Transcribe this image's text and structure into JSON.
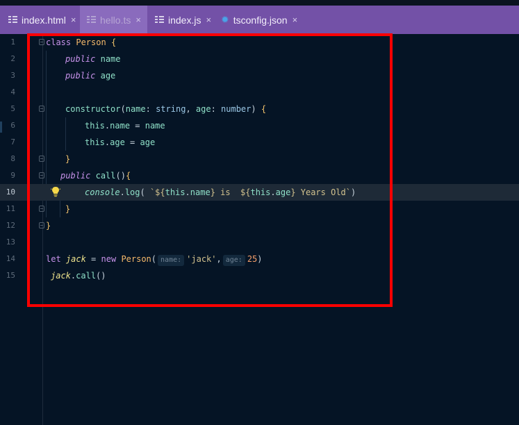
{
  "tabs": [
    {
      "label": "index.html",
      "close": "×",
      "icon": "file-lines-icon"
    },
    {
      "label": "hello.ts",
      "close": "×",
      "icon": "file-lines-icon",
      "active": true
    },
    {
      "label": "index.js",
      "close": "×",
      "icon": "file-lines-icon"
    },
    {
      "label": "tsconfig.json",
      "close": "×",
      "icon": "gear-icon"
    }
  ],
  "line_numbers": [
    "1",
    "2",
    "3",
    "4",
    "5",
    "6",
    "7",
    "8",
    "9",
    "10",
    "11",
    "12",
    "13",
    "14",
    "15"
  ],
  "current_line": "10",
  "code": {
    "l1": {
      "kw": "class",
      "cls": "Person",
      "brace": "{"
    },
    "l2": {
      "kw": "public",
      "name": "name"
    },
    "l3": {
      "kw": "public",
      "name": "age"
    },
    "l5": {
      "fn": "constructor",
      "open": "(",
      "p1": "name",
      "c1": ": ",
      "t1": "string",
      "comma": ", ",
      "p2": "age",
      "c2": ": ",
      "t2": "number",
      "close": ")",
      "brace": "{"
    },
    "l6": {
      "this": "this",
      "dot": ".",
      "prop": "name",
      "eq": " = ",
      "val": "name"
    },
    "l7": {
      "this": "this",
      "dot": ".",
      "prop": "age",
      "eq": " = ",
      "val": "age"
    },
    "l8": {
      "brace": "}"
    },
    "l9": {
      "kw": "public",
      "fn": "call",
      "paren": "()",
      "brace": "{"
    },
    "l10": {
      "obj": "console",
      "dot": ".",
      "fn": "log",
      "open": "(",
      "tpl_start": " `${",
      "this1": "this",
      "dot1": ".",
      "p1": "name",
      "mid": "} is  ${",
      "this2": "this",
      "dot2": ".",
      "p2": "age",
      "end": "} Years Old`",
      "close": ")"
    },
    "l11": {
      "brace": "}"
    },
    "l12": {
      "brace": "}"
    },
    "l14": {
      "kw": "let",
      "var": "jack",
      "eq": " = ",
      "new": "new",
      "cls": "Person",
      "open": "(",
      "hint1": "name:",
      "arg1": "'jack'",
      "comma": ",",
      "hint2": "age:",
      "arg2": "25",
      "close": ")"
    },
    "l15": {
      "var": "jack",
      "dot": ".",
      "fn": "call",
      "paren": "()"
    }
  },
  "colors": {
    "annotation_box": "#ff0000",
    "tabbar": "#7351a7",
    "editor_bg": "#051425"
  }
}
